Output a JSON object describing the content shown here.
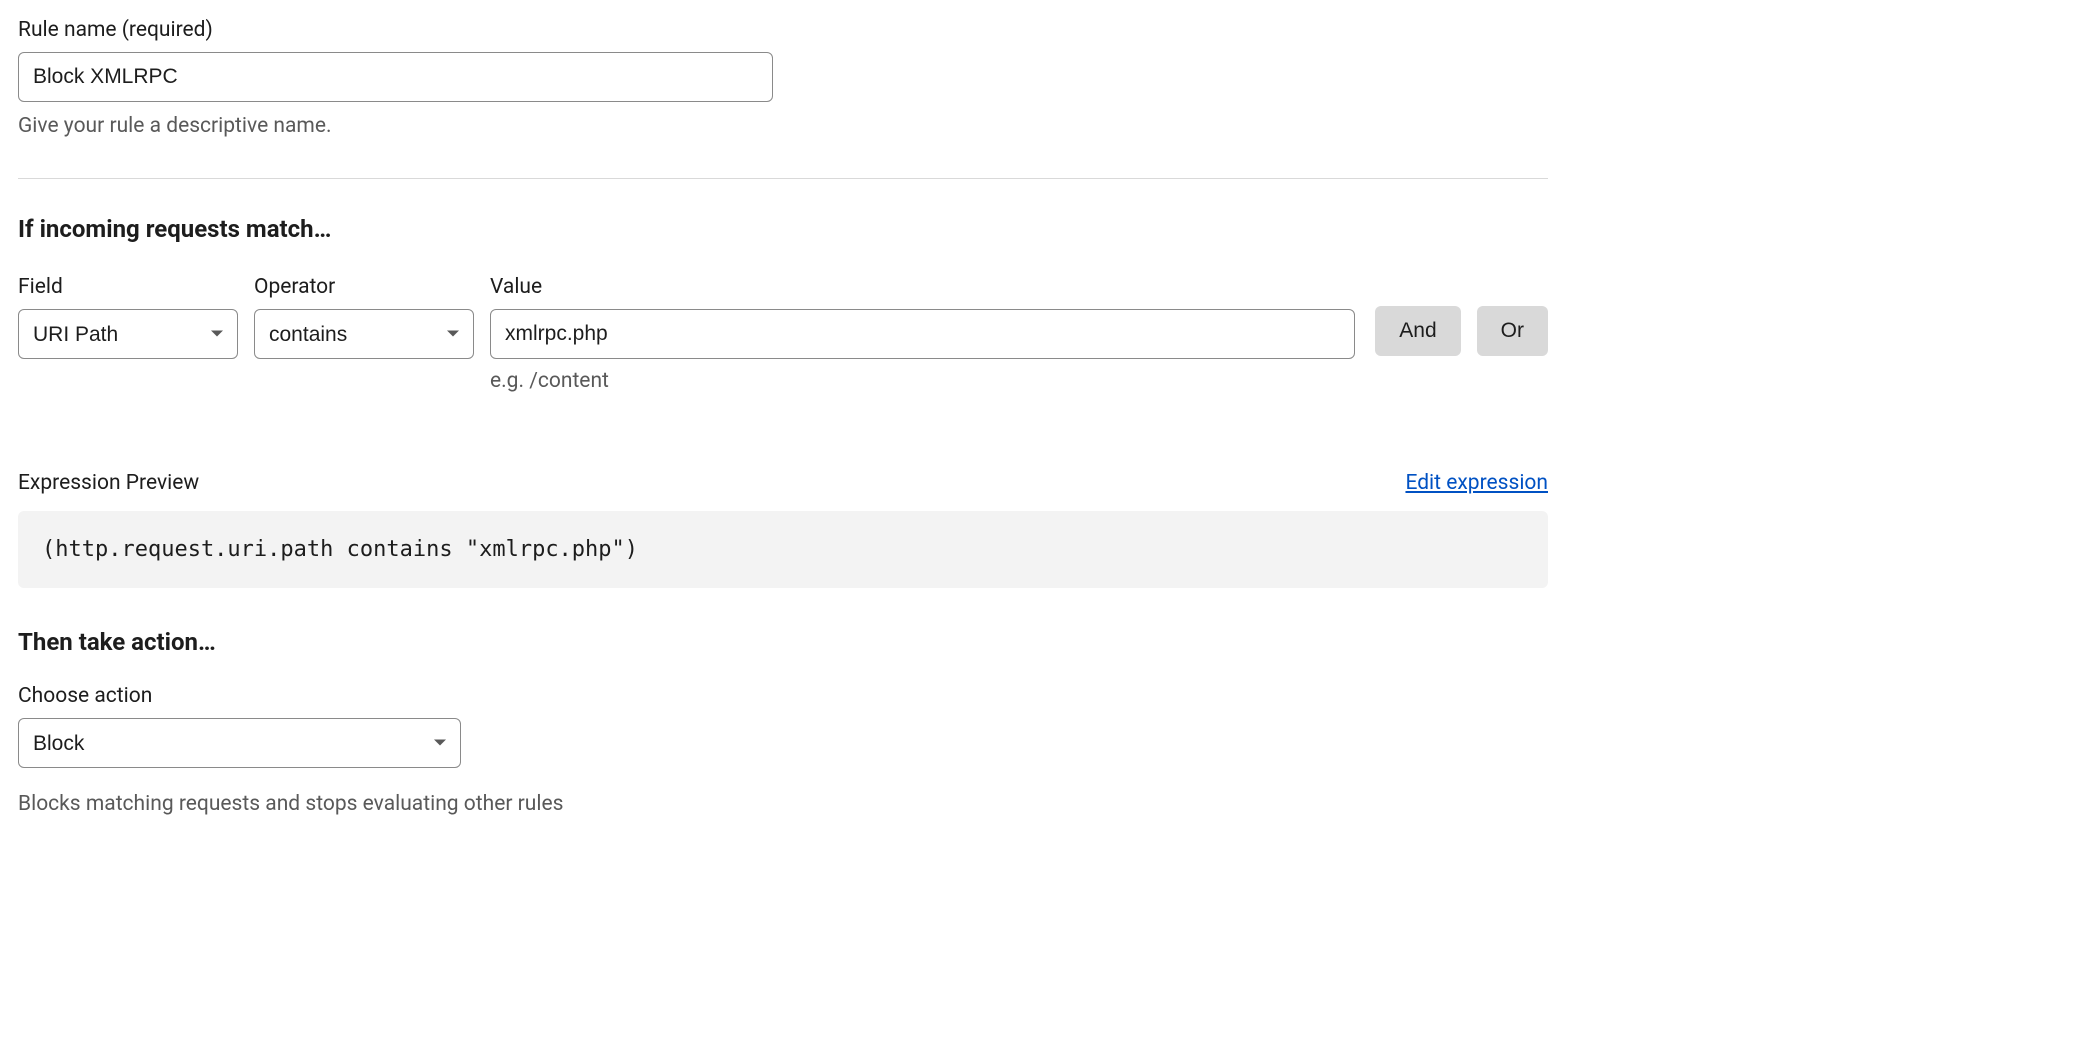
{
  "ruleName": {
    "label": "Rule name (required)",
    "value": "Block XMLRPC",
    "hint": "Give your rule a descriptive name."
  },
  "matchSection": {
    "heading": "If incoming requests match…",
    "fieldLabel": "Field",
    "fieldValue": "URI Path",
    "operatorLabel": "Operator",
    "operatorValue": "contains",
    "valueLabel": "Value",
    "valueValue": "xmlrpc.php",
    "valueHint": "e.g. /content",
    "andLabel": "And",
    "orLabel": "Or"
  },
  "preview": {
    "label": "Expression Preview",
    "editLink": "Edit expression",
    "code": "(http.request.uri.path contains \"xmlrpc.php\")"
  },
  "actionSection": {
    "heading": "Then take action…",
    "chooseLabel": "Choose action",
    "actionValue": "Block",
    "hint": "Blocks matching requests and stops evaluating other rules"
  }
}
